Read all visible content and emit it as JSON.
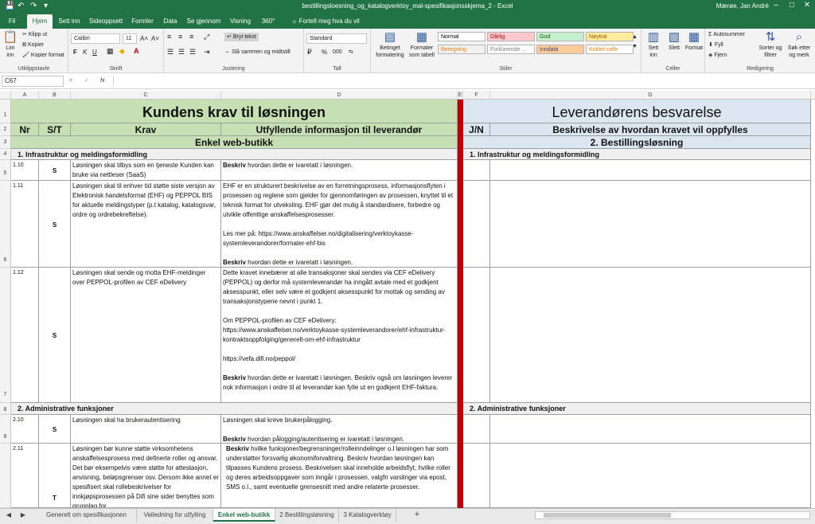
{
  "app": {
    "window_title": "bestillingsloesning_og_katalogverktoy_mal-spesifikasjonsskjema_2 - Excel",
    "user": "Mærøe, Jan André"
  },
  "ribbon_tabs": [
    "Fil",
    "Hjem",
    "Sett inn",
    "Sideoppsett",
    "Formler",
    "Data",
    "Se gjennom",
    "Visning",
    "360°"
  ],
  "active_tab": "Hjem",
  "tell_me": "Fortell meg hva du vil gjøre",
  "ribbon": {
    "clipboard": {
      "label": "Utklippstavle",
      "paste": "Lim inn",
      "cut": "Klipp ut",
      "copy": "Kopier",
      "format_painter": "Kopier format"
    },
    "font": {
      "label": "Skrift",
      "name": "Calibri",
      "size": "11",
      "bold": "F",
      "italic": "K",
      "underline": "U"
    },
    "alignment": {
      "label": "Justering",
      "wrap": "Bryt tekst",
      "merge": "Slå sammen og midtstill"
    },
    "number": {
      "label": "Tall",
      "format": "Standard",
      "percent": "%",
      "comma": "000"
    },
    "styles": {
      "label": "Stiler",
      "conditional": "Betinget formatering",
      "format_table": "Formater som tabell",
      "cells": [
        {
          "name": "Normal",
          "bg": "#ffffff",
          "fg": "#000000"
        },
        {
          "name": "Dårlig",
          "bg": "#ffc7ce",
          "fg": "#9c0006"
        },
        {
          "name": "God",
          "bg": "#c6efce",
          "fg": "#006100"
        },
        {
          "name": "Nøytral",
          "bg": "#ffeb9c",
          "fg": "#9c5700"
        },
        {
          "name": "Beregning",
          "bg": "#f2f2f2",
          "fg": "#fa7d00"
        },
        {
          "name": "Forklarende ...",
          "bg": "#ffffff",
          "fg": "#7f7f7f"
        },
        {
          "name": "Inndata",
          "bg": "#ffcc99",
          "fg": "#3f3f76"
        },
        {
          "name": "Koblet celle",
          "bg": "#ffffff",
          "fg": "#fa7d00"
        }
      ]
    },
    "cells": {
      "label": "Celler",
      "insert": "Sett inn",
      "delete": "Slett",
      "format": "Format"
    },
    "editing": {
      "label": "Redigering",
      "autosum": "Autosummer",
      "fill": "Fyll",
      "clear": "Fjern",
      "sort": "Sorter og filtrer",
      "find": "Søk etter og merk"
    }
  },
  "formula_bar": {
    "name_box": "C67",
    "cancel": "✕",
    "enter": "✓",
    "fx": "fx",
    "value": ""
  },
  "columns": [
    "A",
    "B",
    "C",
    "D",
    "E",
    "F",
    "G"
  ],
  "rows": [
    "1",
    "2",
    "3",
    "4",
    "5",
    "6",
    "7",
    "8",
    "9",
    ""
  ],
  "sheet": {
    "left_title": "Kundens krav til løsningen",
    "right_title": "Leverandørens besvarelse",
    "hdr_nr": "Nr",
    "hdr_st": "S/T",
    "hdr_krav": "Krav",
    "hdr_info": "Utfyllende informasjon til leverandør",
    "hdr_jn": "J/N",
    "hdr_desc": "Beskrivelse av hvordan kravet vil oppfylles",
    "left_subtitle": "Enkel web-butikk",
    "right_subtitle": "2. Bestillingsløsning",
    "sec1_left": "1.  Infrastruktur og meldingsformidling",
    "sec1_right": "1.  Infrastruktur og meldingsformidling",
    "sec2_left": "2. Administrative funksjoner",
    "sec2_right": "2. Administrative funksjoner",
    "req": [
      {
        "nr": "1.10",
        "st": "S",
        "krav": "Løsningen skal tilbys som en tjeneste Kunden kan bruke via nettleser (SaaS)",
        "info": "",
        "info_bold": "Beskriv",
        "info_end": " hvordan dette er ivaretatt i løsningen."
      },
      {
        "nr": "1.11",
        "st": "S",
        "krav": "Løsningen skal til enhver tid støtte siste versjon av Elektronisk handelsformat (EHF) og PEPPOL BIS for aktuelle meldingstyper (p.t katalog, katalogsvar, ordre og ordrebekreftelse).",
        "info": "EHF er en strukturert beskrivelse av en forretningsprosess, informasjonsflyten i prosessen og reglene som gjelder for gjennomføringen av prosessen, knyttet til et teknisk format for utveksling. EHF gjør det mulig å standardisere, forbedre og utvikle offentlige anskaffelsesprosesser.\n\nLes mer på: https://www.anskaffelser.no/digitalisering/verktoykasse-systemleverandorer/formater-ehf-bis\n\n",
        "info_bold": "Beskriv",
        "info_end": " hvordan dette er ivaretatt i løsningen."
      },
      {
        "nr": "1.12",
        "st": "S",
        "krav": "Løsningen skal sende og motta EHF-meldinger over PEPPOL-profilen av CEF eDelivery",
        "info": "Dette kravet innebærer at alle transaksjoner skal sendes via CEF eDelivery (PEPPOL)  og derfor må systemleverandør  ha inngått avtale med et godkjent aksesspunkt, eller selv være et godkjent aksesspunkt for mottak og sending av transaksjonstypene nevnt i punkt 1.\n\nOm PEPPOL-profilen av CEF eDelivery:\nhttps://www.anskaffelser.no/verktoykasse-systemleverandorer/ehf-infrastruktur-kontraktsoppfolging/generelt-om-ehf-infrastruktur\n\nhttps://vefa.difi.no/peppol/\n\n",
        "info_bold": "Beskriv",
        "info_end": " hvordan dette er ivaretatt i løsningen. Beskriv også om løsningen leverer nok informasjon i ordre til at leverandør kan fylle ut en godkjent EHF-faktura."
      },
      {
        "nr": "2.10",
        "st": "S",
        "krav": "Løsningen skal ha brukerautentisering",
        "info": "Løsningen skal kreve brukerpålogging.\n\n",
        "info_bold": "Beskriv",
        "info_end": " hvordan pålogging/autentisering er ivaretatt i løsningen."
      },
      {
        "nr": "2.11",
        "st": "T",
        "krav": "Løsningen bør kunne støtte virksomhetens anskaffelsesprosess med definerte roller og ansvar. Det bør eksempelvis være støtte for attestasjon, anvisning, beløpsgrenser osv. Dersom ikke annet er spesifisert skal rollebeskrivelser for innkjøpsprosessen på Difi sine sider benyttes som grunnlag for",
        "info": "",
        "info_bold": "Beskriv",
        "info_end": " hvilke funksjoner/begrensninger/rolleinndelinger o.l løsningen har som understøtter forsvarlig økonomiforvaltning. Beskriv hvordan løsningen kan tilpasses Kundens prosess. Beskrivelsen skal inneholde arbeidsflyt, hvilke roller og deres arbeidsoppgaver som inngår i prosessen, valgfri varslinger via epost, SMS o.l., samt eventuelle grensesnitt med andre relaterte prosesser."
      }
    ]
  },
  "sheet_tabs": [
    "Generelt om spesifikasjonen",
    "Veiledning for utfylling",
    "Enkel web-butikk",
    "2 Bestillingsløsning",
    "3 Katalogverktøy"
  ],
  "active_sheet": "Enkel web-butikk",
  "add_sheet": "+",
  "colors": {
    "excel_green": "#217346",
    "req_green": "#c6e0b4",
    "resp_blue": "#dce6f1",
    "divider_red": "#c00000"
  }
}
